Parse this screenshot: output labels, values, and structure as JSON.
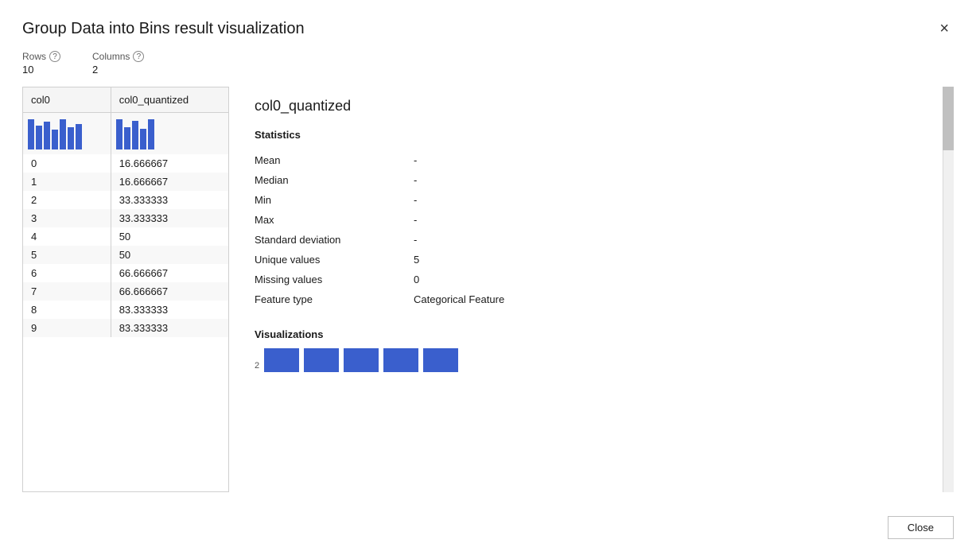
{
  "modal": {
    "title": "Group Data into Bins result visualization",
    "close_label": "×"
  },
  "meta": {
    "rows_label": "Rows",
    "rows_value": "10",
    "cols_label": "Columns",
    "cols_value": "2"
  },
  "table": {
    "col0_header": "col0",
    "col1_header": "col0_quantized",
    "rows": [
      {
        "index": "0",
        "value": "16.666667"
      },
      {
        "index": "1",
        "value": "16.666667"
      },
      {
        "index": "2",
        "value": "33.333333"
      },
      {
        "index": "3",
        "value": "33.333333"
      },
      {
        "index": "4",
        "value": "50"
      },
      {
        "index": "5",
        "value": "50"
      },
      {
        "index": "6",
        "value": "66.666667"
      },
      {
        "index": "7",
        "value": "66.666667"
      },
      {
        "index": "8",
        "value": "83.333333"
      },
      {
        "index": "9",
        "value": "83.333333"
      }
    ]
  },
  "right_panel": {
    "column_name": "col0_quantized",
    "statistics_label": "Statistics",
    "stats": [
      {
        "label": "Mean",
        "value": "-"
      },
      {
        "label": "Median",
        "value": "-"
      },
      {
        "label": "Min",
        "value": "-"
      },
      {
        "label": "Max",
        "value": "-"
      },
      {
        "label": "Standard deviation",
        "value": "-"
      },
      {
        "label": "Unique values",
        "value": "5"
      },
      {
        "label": "Missing values",
        "value": "0"
      },
      {
        "label": "Feature type",
        "value": "Categorical Feature"
      }
    ],
    "visualizations_label": "Visualizations",
    "viz_bar_top_label": "2",
    "viz_bars": [
      {
        "height": 30
      },
      {
        "height": 30
      },
      {
        "height": 30
      },
      {
        "height": 30
      },
      {
        "height": 30
      }
    ]
  },
  "footer": {
    "close_button_label": "Close"
  },
  "mini_bars_col0": [
    {
      "height": 38
    },
    {
      "height": 30
    },
    {
      "height": 35
    },
    {
      "height": 25
    },
    {
      "height": 38
    },
    {
      "height": 28
    },
    {
      "height": 32
    }
  ],
  "mini_bars_col0q": [
    {
      "height": 38
    },
    {
      "height": 28
    },
    {
      "height": 36
    },
    {
      "height": 26
    },
    {
      "height": 38
    }
  ]
}
